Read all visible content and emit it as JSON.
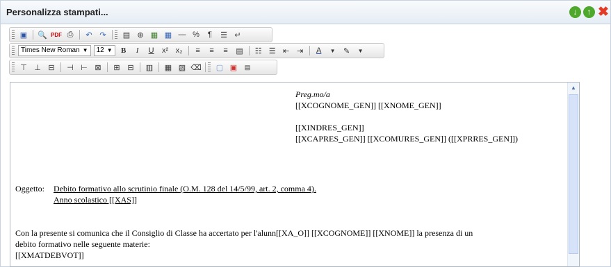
{
  "window": {
    "title": "Personalizza stampati..."
  },
  "toolbar": {
    "font_name": "Times New Roman",
    "font_size": "12",
    "row1": [
      "save-icon",
      "preview-icon",
      "find-icon",
      "pdf-icon",
      "print-icon",
      "undo-icon",
      "redo-icon",
      "textfield-icon",
      "insert-symbol-icon",
      "insert-image-icon",
      "insert-table-icon",
      "horizontal-rule-icon",
      "special-char-icon",
      "pilcrow-icon",
      "page-break-icon",
      "line-break-icon"
    ],
    "row2": [
      "bold-icon",
      "italic-icon",
      "underline-icon",
      "superscript-icon",
      "subscript-icon",
      "align-left-icon",
      "align-center-icon",
      "align-right-icon",
      "justify-icon",
      "ordered-list-icon",
      "unordered-list-icon",
      "outdent-icon",
      "indent-icon",
      "font-color-icon",
      "highlight-icon"
    ],
    "row3": [
      "insert-row-above-icon",
      "insert-row-below-icon",
      "delete-row-icon",
      "insert-col-left-icon",
      "insert-col-right-icon",
      "delete-col-icon",
      "merge-cells-icon",
      "split-cells-icon",
      "cell-props-icon",
      "table-props-icon",
      "table-copy-icon",
      "eraser-icon",
      "borders-icon",
      "show-blocks-icon",
      "source-icon"
    ]
  },
  "document": {
    "greeting": "Preg.mo/a",
    "addr1": "[[XCOGNOME_GEN]] [[XNOME_GEN]]",
    "addr2": "[[XINDRES_GEN]]",
    "addr3": "[[XCAPRES_GEN]] [[XCOMURES_GEN]] ([[XPRRES_GEN]])",
    "oggetto_label": "Oggetto:",
    "oggetto_text": "Debito formativo allo scrutinio finale (O.M. 128 del 14/5/99, art. 2, comma 4).",
    "anno_text": "Anno scolastico [[XAS]]",
    "body1": "Con la  presente si comunica che il Consiglio di Classe ha accertato per l'alunn[[XA_O]] [[XCOGNOME]] [[XNOME]] la presenza di un",
    "body2": "debito formativo nelle seguente materie:",
    "body3": "[[XMATDEBVOT]]"
  }
}
